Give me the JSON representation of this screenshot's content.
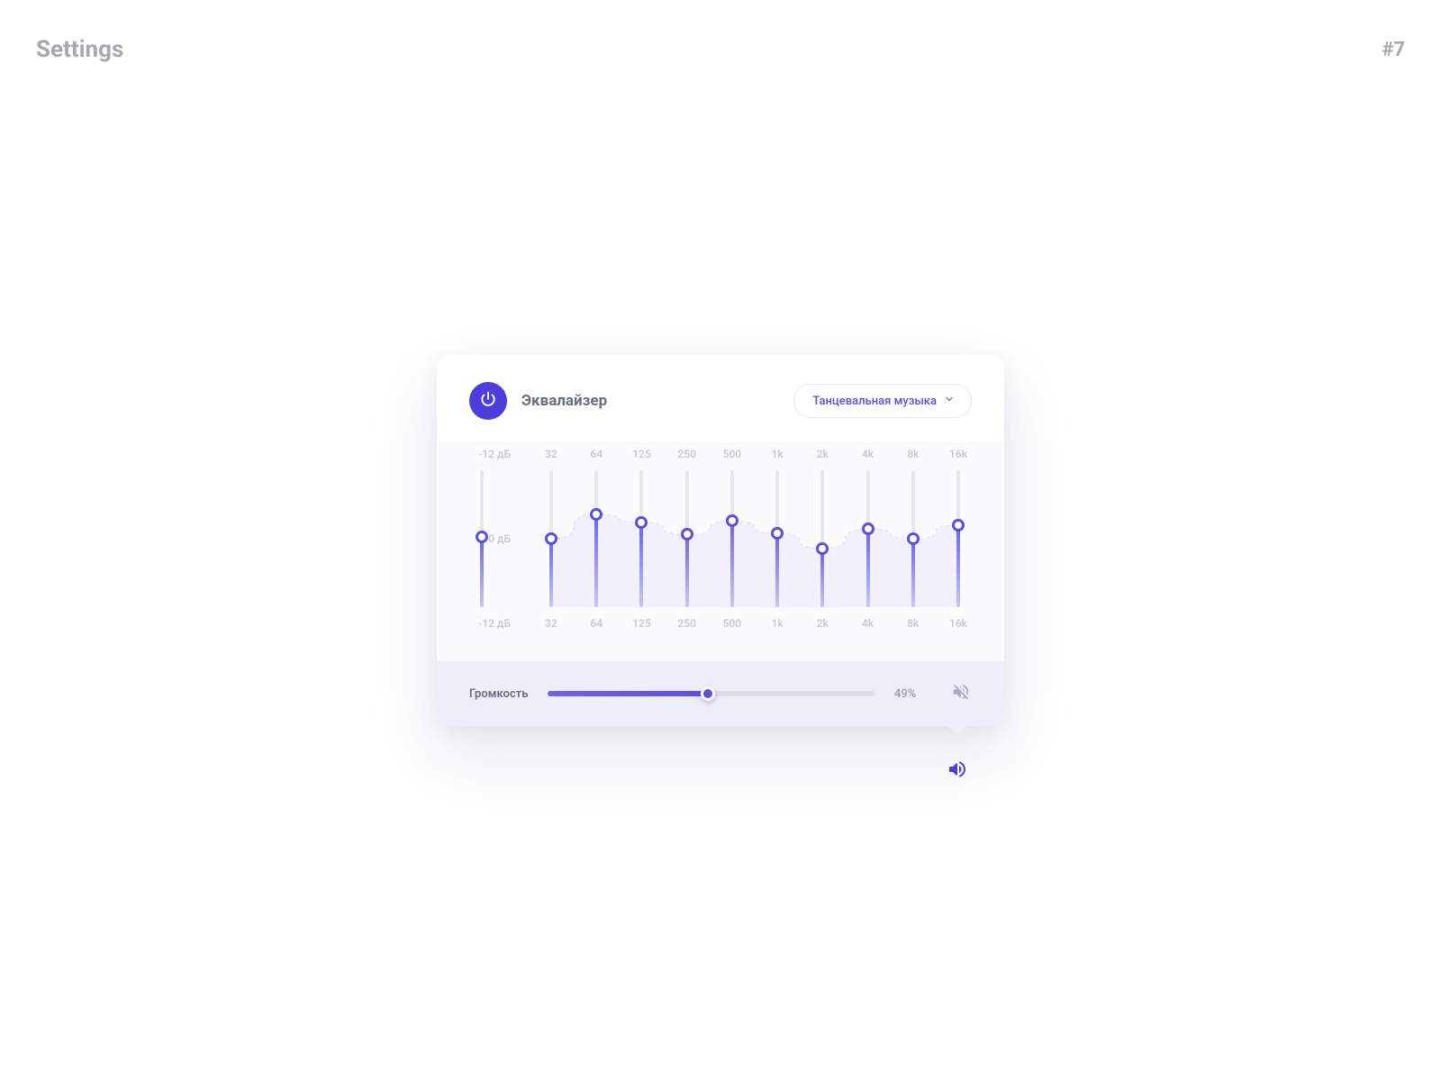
{
  "page": {
    "title": "Settings",
    "number": "#7"
  },
  "equalizer": {
    "title": "Эквалайзер",
    "preset": "Танцевальная музыка",
    "scale": {
      "top": "-12 дБ",
      "mid": "0 дБ",
      "bottom": "-12 дБ",
      "value_pct": 51
    },
    "bands": [
      {
        "freq": "32",
        "value_pct": 50
      },
      {
        "freq": "64",
        "value_pct": 68
      },
      {
        "freq": "125",
        "value_pct": 62
      },
      {
        "freq": "250",
        "value_pct": 53
      },
      {
        "freq": "500",
        "value_pct": 63
      },
      {
        "freq": "1k",
        "value_pct": 54
      },
      {
        "freq": "2k",
        "value_pct": 43
      },
      {
        "freq": "4k",
        "value_pct": 57
      },
      {
        "freq": "8k",
        "value_pct": 50
      },
      {
        "freq": "16k",
        "value_pct": 60
      }
    ]
  },
  "volume": {
    "label": "Громкость",
    "pct": 49,
    "pct_text": "49%"
  },
  "colors": {
    "accent": "#4B3EDD"
  }
}
